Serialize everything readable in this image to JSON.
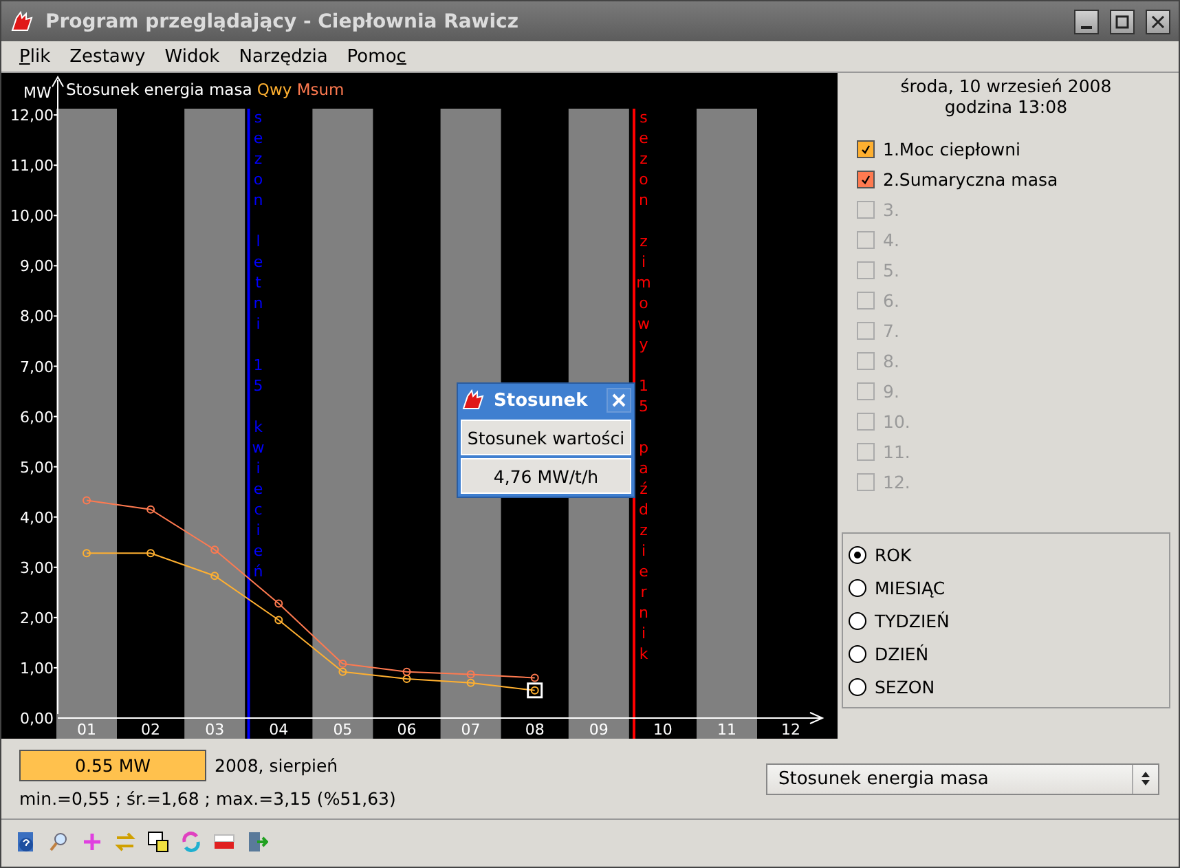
{
  "window": {
    "title": "Program przeglądający - Ciepłownia Rawicz"
  },
  "menu": [
    {
      "label": "Plik",
      "underline_first": true,
      "underline_last": false
    },
    {
      "label": "Zestawy",
      "underline_first": false,
      "underline_last": false
    },
    {
      "label": "Widok",
      "underline_first": false,
      "underline_last": false
    },
    {
      "label": "Narzędzia",
      "underline_first": false,
      "underline_last": false
    },
    {
      "label": "Pomoc",
      "underline_first": false,
      "underline_last": true
    }
  ],
  "chart": {
    "chart_data": {
      "type": "line",
      "title": "Stosunek energia masa",
      "ylabel": "MW",
      "categories": [
        "01",
        "02",
        "03",
        "04",
        "05",
        "06",
        "07",
        "08",
        "09",
        "10",
        "11",
        "12"
      ],
      "ylim": [
        0,
        12.7
      ],
      "yticks": [
        {
          "value": 0,
          "label": "0,00"
        },
        {
          "value": 1,
          "label": "1,00"
        },
        {
          "value": 2,
          "label": "2,00"
        },
        {
          "value": 3,
          "label": "3,00"
        },
        {
          "value": 4,
          "label": "4,00"
        },
        {
          "value": 5,
          "label": "5,00"
        },
        {
          "value": 6,
          "label": "6,00"
        },
        {
          "value": 7,
          "label": "7,00"
        },
        {
          "value": 8,
          "label": "8,00"
        },
        {
          "value": 9,
          "label": "9,00"
        },
        {
          "value": 10,
          "label": "10,00"
        },
        {
          "value": 11,
          "label": "11,00"
        },
        {
          "value": 12,
          "label": "12,00"
        }
      ],
      "series": [
        {
          "name": "Qwy",
          "color": "#ffb030",
          "marker": "o",
          "values": [
            3.28,
            3.28,
            2.83,
            1.95,
            0.92,
            0.78,
            0.7,
            0.55,
            null,
            null,
            null,
            null
          ]
        },
        {
          "name": "Msum",
          "color": "#ff7a50",
          "marker": "o",
          "values": [
            4.33,
            4.15,
            3.35,
            2.28,
            1.08,
            0.92,
            0.87,
            0.8,
            null,
            null,
            null,
            null
          ]
        }
      ]
    },
    "highlight_last_point": true,
    "seasons": [
      {
        "kind": "summer",
        "text": "sezon letni 15 kwiecień",
        "color": "#0000ff"
      },
      {
        "kind": "winter",
        "text": "sezon zimowy 15 październik",
        "color": "#ff0000"
      }
    ],
    "popup": {
      "title": "Stosunek",
      "label": "Stosunek wartości",
      "value": "4,76 MW/t/h"
    }
  },
  "side": {
    "date": "środa, 10 wrzesień 2008",
    "time": "godzina 13:08",
    "series": [
      {
        "label": "1.Moc ciepłowni",
        "checked": true,
        "disabled": false,
        "color": "#ffb030"
      },
      {
        "label": "2.Sumaryczna masa",
        "checked": true,
        "disabled": false,
        "color": "#ff7a50"
      },
      {
        "label": "3.",
        "checked": false,
        "disabled": true
      },
      {
        "label": "4.",
        "checked": false,
        "disabled": true
      },
      {
        "label": "5.",
        "checked": false,
        "disabled": true
      },
      {
        "label": "6.",
        "checked": false,
        "disabled": true
      },
      {
        "label": "7.",
        "checked": false,
        "disabled": true
      },
      {
        "label": "8.",
        "checked": false,
        "disabled": true
      },
      {
        "label": "9.",
        "checked": false,
        "disabled": true
      },
      {
        "label": "10.",
        "checked": false,
        "disabled": true
      },
      {
        "label": "11.",
        "checked": false,
        "disabled": true
      },
      {
        "label": "12.",
        "checked": false,
        "disabled": true
      }
    ],
    "periods": [
      {
        "label": "ROK",
        "selected": true
      },
      {
        "label": "MIESIĄC",
        "selected": false
      },
      {
        "label": "TYDZIEŃ",
        "selected": false
      },
      {
        "label": "DZIEŃ",
        "selected": false
      },
      {
        "label": "SEZON",
        "selected": false
      }
    ]
  },
  "info": {
    "value": "0.55 MW",
    "period": "2008, sierpień",
    "stats": "min.=0,55 ; śr.=1,68 ; max.=3,15  (%51,63)",
    "select": "Stosunek energia masa"
  }
}
